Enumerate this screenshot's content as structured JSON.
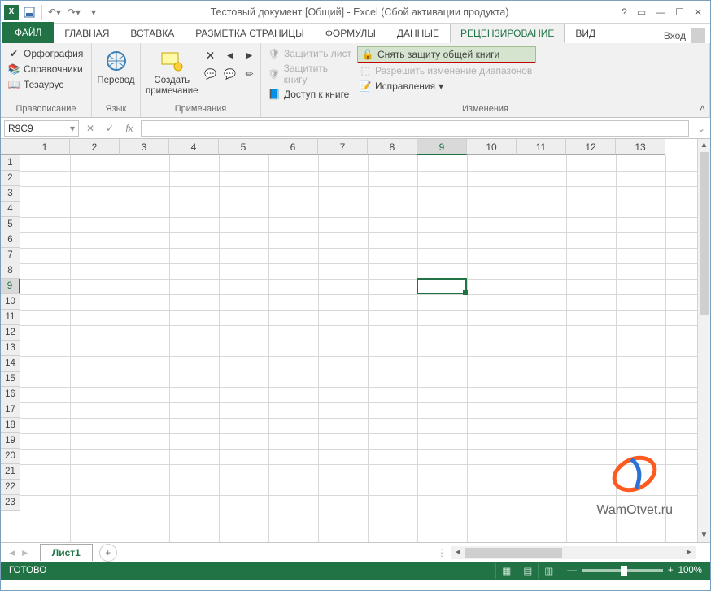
{
  "title": "Тестовый документ  [Общий] - Excel (Сбой активации продукта)",
  "login_label": "Вход",
  "tabs": {
    "file": "ФАЙЛ",
    "home": "ГЛАВНАЯ",
    "insert": "ВСТАВКА",
    "layout": "РАЗМЕТКА СТРАНИЦЫ",
    "formulas": "ФОРМУЛЫ",
    "data": "ДАННЫЕ",
    "review": "РЕЦЕНЗИРОВАНИЕ",
    "view": "ВИД"
  },
  "ribbon": {
    "proofing": {
      "spelling": "Орфография",
      "research": "Справочники",
      "thesaurus": "Тезаурус",
      "label": "Правописание"
    },
    "language": {
      "translate": "Перевод",
      "label": "Язык"
    },
    "comments": {
      "new": "Создать примечание",
      "label": "Примечания"
    },
    "changes": {
      "protect_sheet": "Защитить лист",
      "protect_book": "Защитить книгу",
      "share_book": "Доступ к книге",
      "unprotect_shared": "Снять защиту общей книги",
      "allow_ranges": "Разрешить изменение диапазонов",
      "track_changes": "Исправления",
      "label": "Изменения"
    }
  },
  "namebox": "R9C9",
  "columns": [
    "1",
    "2",
    "3",
    "4",
    "5",
    "6",
    "7",
    "8",
    "9",
    "10",
    "11",
    "12",
    "13"
  ],
  "rows": [
    "1",
    "2",
    "3",
    "4",
    "5",
    "6",
    "7",
    "8",
    "9",
    "10",
    "11",
    "12",
    "13",
    "14",
    "15",
    "16",
    "17",
    "18",
    "19",
    "20",
    "21",
    "22",
    "23"
  ],
  "selected_col_index": 8,
  "selected_row_index": 8,
  "sheet": {
    "name": "Лист1"
  },
  "status": {
    "ready": "ГОТОВО",
    "zoom": "100%"
  },
  "watermark": "WamOtvet.ru"
}
